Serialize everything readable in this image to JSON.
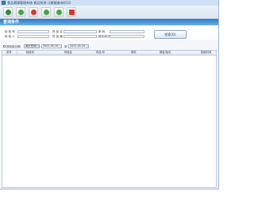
{
  "window": {
    "title": "食品溯源管理系统 食品检测-元数据查询/打印"
  },
  "toolbar": {
    "buttons": [
      {
        "icon": "home-icon",
        "color": "#2e8b3a"
      },
      {
        "icon": "refresh-icon",
        "color": "#3fa64a"
      },
      {
        "icon": "delete-icon",
        "color": "#d23a2c"
      },
      {
        "icon": "next-icon",
        "color": "#3fa64a"
      },
      {
        "icon": "export-icon",
        "color": "#3fa64a"
      },
      {
        "icon": "close-icon",
        "color": "#d23a2c"
      }
    ]
  },
  "section": {
    "title": "查询条件"
  },
  "form": {
    "row1": {
      "label1": "检 验 号",
      "label2": "样 品 名",
      "label3": "条    码"
    },
    "row2": {
      "label1": "检 验 人",
      "label2": "样 品 编 号",
      "label3": "报告/批次"
    },
    "query_button": "检索(Q)"
  },
  "dates": {
    "checkbox_label": "按检验日期",
    "mode": "最近检测(Y)",
    "from": "2022-05-20",
    "to_label": "到",
    "to": "2022-05-20"
  },
  "grid": {
    "columns": [
      "序号",
      "检验号",
      "样品名",
      "样品 号",
      "条码",
      "报告/批次",
      "检验时间"
    ]
  },
  "colors": {
    "header_blue": "#2a79c9",
    "toolbar_bg": "#dbe6f3"
  }
}
